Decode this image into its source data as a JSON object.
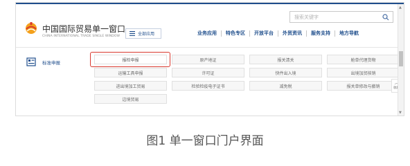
{
  "header": {
    "search_placeholder": "搜索关键字",
    "brand_cn": "中国国际贸易单一窗口",
    "brand_en": "CHINA INTERNATIONAL TRADE SINGLE WINDOW",
    "all_apps_label": "全部应用",
    "nav": [
      "业务应用",
      "特色专区",
      "开放平台",
      "外贸资讯",
      "服务支持",
      "地方导航"
    ]
  },
  "category": {
    "label": "标准申报",
    "items": [
      "报检申报",
      "原产地证",
      "报关清关",
      "舱单代理货物",
      "运输工具申报",
      "许可证",
      "快件出入境",
      "出境加贸核销",
      "进出境加工贸易",
      "检验检疫电子证书",
      "减免税",
      "报关单修改与撤销",
      "边境贸易"
    ],
    "active_index": 0
  },
  "collapse_label": "收起",
  "caption": "图1  单一窗口门户界面",
  "colors": {
    "brand_blue": "#1f4e8c",
    "highlight_red": "#d9382e"
  }
}
